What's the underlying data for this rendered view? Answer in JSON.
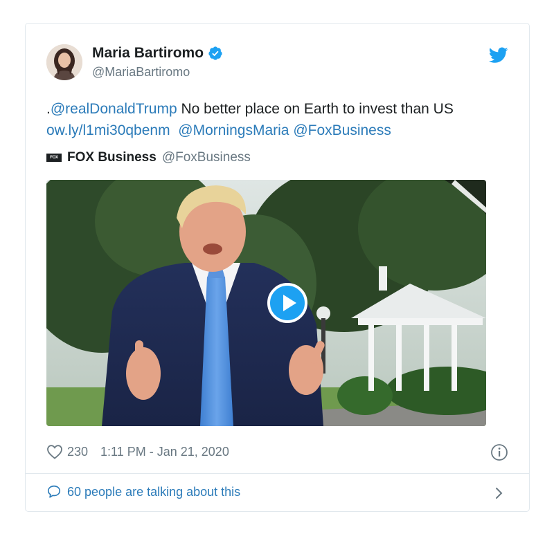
{
  "author": {
    "name": "Maria Bartiromo",
    "handle": "@MariaBartiromo",
    "verified": true
  },
  "icons": {
    "avatar": "avatar-photo",
    "verified": "verified-badge-icon",
    "brand": "twitter-bird-icon",
    "source_logo": "fox-business-logo",
    "play": "play-icon",
    "like": "heart-icon",
    "info": "info-icon",
    "comments": "speech-bubble-icon",
    "more": "chevron-right-icon"
  },
  "tweet": {
    "prefix": ".",
    "mention_trump": "@realDonaldTrump",
    "text": " No better place on Earth to invest than US",
    "link": "ow.ly/l1mi30qbenm",
    "mention_mornings": "@MorningsMaria",
    "mention_fox": "@FoxBusiness"
  },
  "source": {
    "logo_text": "FOX BUSINESS",
    "name": "FOX Business",
    "handle": "@FoxBusiness"
  },
  "media": {
    "type": "video"
  },
  "stats": {
    "likes": "230",
    "timestamp": "1:11 PM - Jan 21, 2020"
  },
  "footer": {
    "talking": "60 people are talking about this"
  },
  "colors": {
    "link": "#2b7bb9",
    "verified": "#1da1f2",
    "muted": "#697882",
    "border": "#e1e8ed"
  }
}
